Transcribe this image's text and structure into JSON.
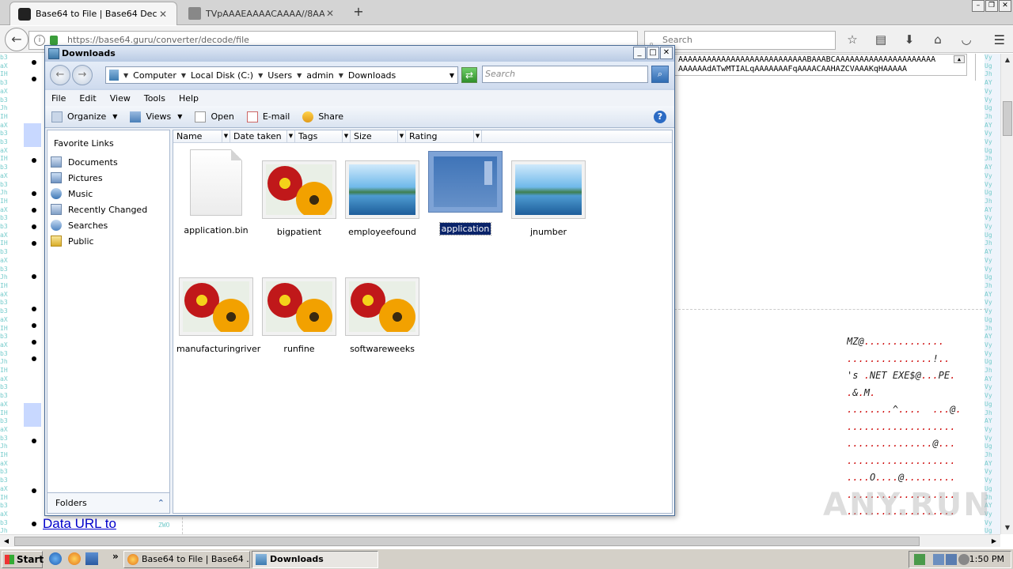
{
  "browser": {
    "tabs": [
      {
        "title": "Base64 to File | Base64 Deco...",
        "active": true
      },
      {
        "title": "TVpAAAEAAAACAAAA//8AAL...",
        "active": false
      }
    ],
    "url": "https://base64.guru/converter/decode/file",
    "search_placeholder": "Search"
  },
  "page": {
    "b64_lines": [
      "AAAAAAAAAAAAAAAAAAAAAAAAAAABAAABCAAAAAAAAAAAAAAAAAAAAA",
      "AAAAAAdATwMTIALqAAAAAAAFqAAAACAAHAZCVAAAKqHAAAAA"
    ],
    "link_text": "Data URL to",
    "zwo": "ZWO",
    "hex_lines": [
      "MZ@..............",
      "...............!..",
      "'s .NET EXE$@...PE.",
      ".&.M.",
      "........^....  ...@.",
      "...................",
      "...............@...",
      "...................",
      "....O....@.........",
      "...................",
      "..................."
    ],
    "watermark": "ANY.RUN"
  },
  "explorer": {
    "title": "Downloads",
    "breadcrumbs": [
      "Computer",
      "Local Disk (C:)",
      "Users",
      "admin",
      "Downloads"
    ],
    "search_placeholder": "Search",
    "menu": [
      "File",
      "Edit",
      "View",
      "Tools",
      "Help"
    ],
    "toolbar": {
      "organize": "Organize",
      "views": "Views",
      "open": "Open",
      "email": "E-mail",
      "share": "Share"
    },
    "favorite_links_title": "Favorite Links",
    "favorites": [
      {
        "label": "Documents",
        "icon": "documents-icon"
      },
      {
        "label": "Pictures",
        "icon": "pictures-icon"
      },
      {
        "label": "Music",
        "icon": "music-icon"
      },
      {
        "label": "Recently Changed",
        "icon": "recently-changed-icon"
      },
      {
        "label": "Searches",
        "icon": "searches-icon"
      },
      {
        "label": "Public",
        "icon": "public-folder-icon"
      }
    ],
    "folders_label": "Folders",
    "columns": [
      "Name",
      "Date taken",
      "Tags",
      "Size",
      "Rating"
    ],
    "files": [
      {
        "name": "application.bin",
        "kind": "blank"
      },
      {
        "name": "bigpatient",
        "kind": "flower"
      },
      {
        "name": "employeefound",
        "kind": "landscape"
      },
      {
        "name": "application",
        "kind": "app",
        "selected": true
      },
      {
        "name": "jnumber",
        "kind": "landscape"
      },
      {
        "name": "manufacturingriver",
        "kind": "flower"
      },
      {
        "name": "runfine",
        "kind": "flower"
      },
      {
        "name": "softwareweeks",
        "kind": "flower"
      }
    ]
  },
  "taskbar": {
    "start": "Start",
    "tasks": [
      {
        "label": "Base64 to File | Base64 ...",
        "active": false
      },
      {
        "label": "Downloads",
        "active": true
      }
    ],
    "clock": "1:50 PM"
  }
}
